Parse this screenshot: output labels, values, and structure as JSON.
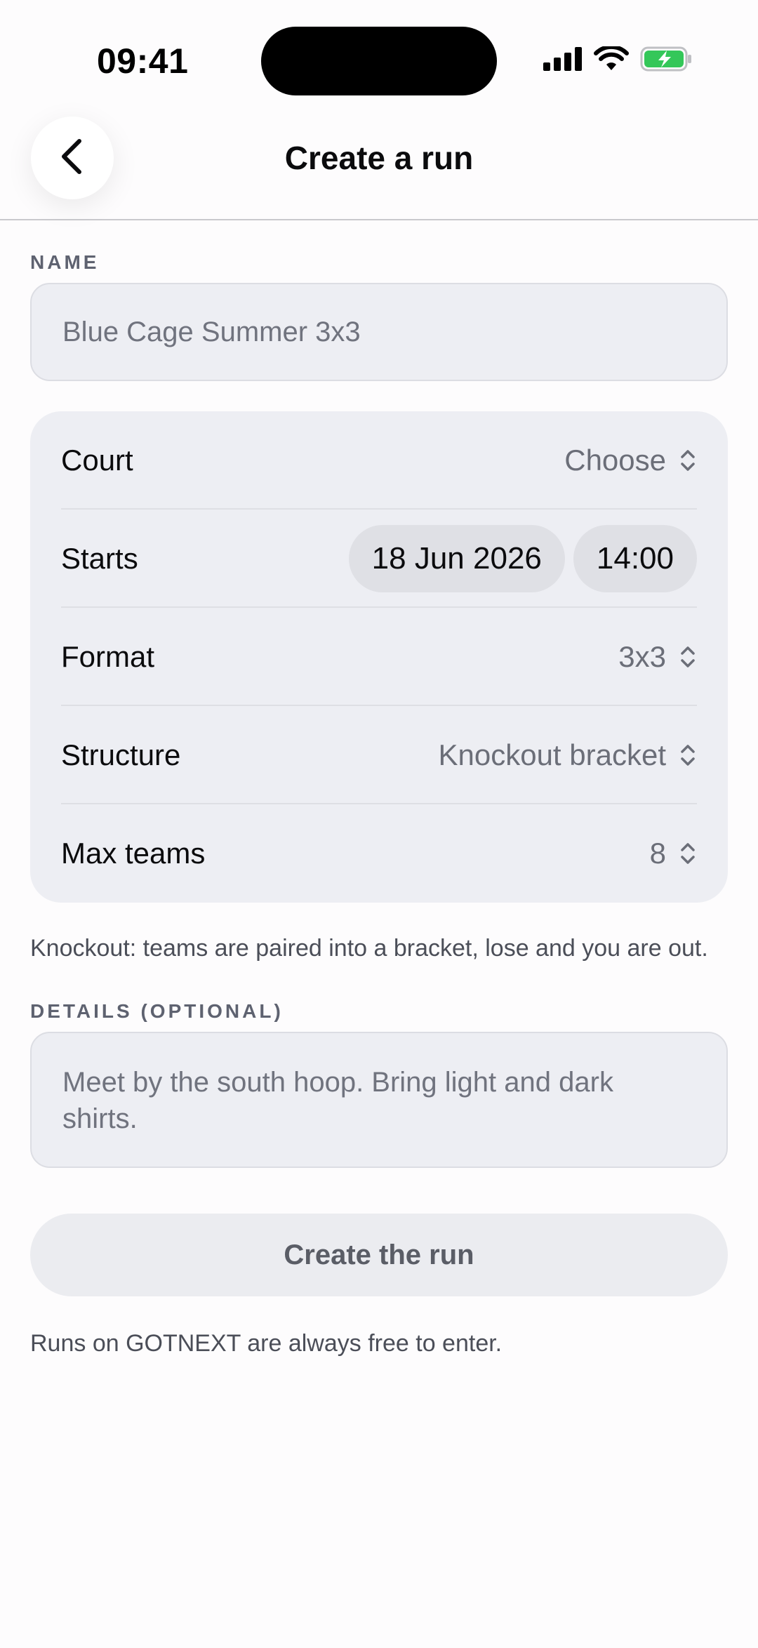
{
  "status_bar": {
    "time": "09:41",
    "battery_color": "#34c759"
  },
  "nav": {
    "title": "Create a run",
    "back_icon": "chevron-left-icon"
  },
  "form": {
    "name_label": "NAME",
    "name_placeholder": "Blue Cage Summer 3x3",
    "rows": [
      {
        "label": "Court",
        "value": "Choose",
        "icon": "chevron-up-down-icon"
      },
      {
        "label": "Starts",
        "date": "18 Jun 2026",
        "time": "14:00"
      },
      {
        "label": "Format",
        "value": "3x3",
        "icon": "chevron-up-down-icon"
      },
      {
        "label": "Structure",
        "value": "Knockout bracket",
        "icon": "chevron-up-down-icon"
      },
      {
        "label": "Max teams",
        "value": "8",
        "icon": "chevron-up-down-icon"
      }
    ],
    "structure_note": "Knockout: teams are paired into a bracket, lose and you are out.",
    "details_label": "DETAILS (OPTIONAL)",
    "details_placeholder": "Meet by the south hoop. Bring light and dark shirts.",
    "submit_label": "Create the run",
    "footer_note": "Runs on GOTNEXT are always free to enter."
  }
}
